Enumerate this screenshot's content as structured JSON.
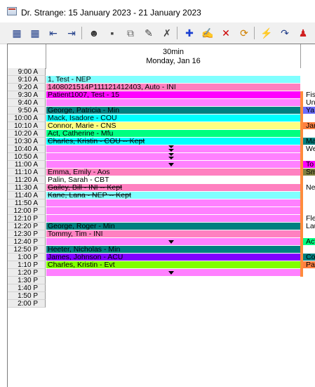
{
  "window": {
    "title": "Dr. Strange: 15 January 2023 - 21 January 2023"
  },
  "toolbar": {
    "buttons": [
      {
        "name": "day-view-icon",
        "glyph": "▦",
        "color": "#1f3c88"
      },
      {
        "name": "week-view-icon",
        "glyph": "▦",
        "color": "#1f3c88"
      },
      {
        "name": "prev-period-icon",
        "glyph": "⇤",
        "color": "#1f3c88"
      },
      {
        "name": "next-period-icon",
        "glyph": "⇥",
        "color": "#1f3c88"
      },
      {
        "name": "find-patient-icon",
        "glyph": "☻",
        "color": "#333333"
      },
      {
        "name": "move-icon",
        "glyph": "▪",
        "color": "#444444"
      },
      {
        "name": "copy-icon",
        "glyph": "⧉",
        "color": "#666666"
      },
      {
        "name": "edit-patient-icon",
        "glyph": "✎",
        "color": "#444444"
      },
      {
        "name": "tools-icon",
        "glyph": "✗",
        "color": "#444444"
      },
      {
        "name": "add-appointment-icon",
        "glyph": "✚",
        "color": "#1a3fd1"
      },
      {
        "name": "edit-appointment-icon",
        "glyph": "✍",
        "color": "#333333"
      },
      {
        "name": "delete-appointment-icon",
        "glyph": "✕",
        "color": "#cc0000"
      },
      {
        "name": "refresh-icon",
        "glyph": "⟳",
        "color": "#d08000"
      },
      {
        "name": "flash-icon",
        "glyph": "⚡",
        "color": "#e0b000"
      },
      {
        "name": "redo-icon",
        "glyph": "↷",
        "color": "#1f3c88"
      },
      {
        "name": "user-alert-icon",
        "glyph": "♟",
        "color": "#d02020"
      }
    ]
  },
  "column": {
    "interval": "30min",
    "date": "Monday, Jan 16"
  },
  "slots": [
    {
      "time": "9:00 A",
      "text": "",
      "color": "#ffffff",
      "marker": "",
      "strike": false,
      "side": "",
      "side_color": "#ffffff",
      "strip": "#ffffff"
    },
    {
      "time": "9:10 A",
      "text": "1, Test -  NEP",
      "color": "#80ffff",
      "marker": "",
      "strike": false,
      "side": "",
      "side_color": "#ffffff",
      "strip": "#ffffff"
    },
    {
      "time": "9:20 A",
      "text": "1408021514P111121412403, Auto -  INI",
      "color": "#ff80c0",
      "marker": "",
      "strike": false,
      "side": "",
      "side_color": "#ffffff",
      "strip": "#ffffff"
    },
    {
      "time": "9:30 A",
      "text": "Patient1007, Test -  15",
      "color": "#ff00ff",
      "marker": "",
      "strike": false,
      "side": "Fis",
      "side_color": "#ffffff",
      "strip": "#ff8c3c"
    },
    {
      "time": "9:40 A",
      "text": "",
      "color": "#ff80ff",
      "marker": "",
      "strike": false,
      "side": "Un",
      "side_color": "#ffffff",
      "strip": "#ff8c3c"
    },
    {
      "time": "9:50 A",
      "text": "George, Patricia -  Min",
      "color": "#008080",
      "marker": "",
      "strike": false,
      "side": "Ya",
      "side_color": "#6a6cff",
      "strip": "#ff8c3c"
    },
    {
      "time": "10:00 A",
      "text": "Mack, Isadore -  COU",
      "color": "#00ffff",
      "marker": "",
      "strike": false,
      "side": "",
      "side_color": "#ffffff",
      "strip": "#ff8c3c"
    },
    {
      "time": "10:10 A",
      "text": "Connor, Marie -  CNS",
      "color": "#ffff80",
      "marker": "",
      "strike": false,
      "side": "Jar",
      "side_color": "#ff8040",
      "strip": "#ff8c3c"
    },
    {
      "time": "10:20 A",
      "text": "Act, Catherine -  Mfu",
      "color": "#00ff80",
      "marker": "",
      "strike": false,
      "side": "",
      "side_color": "#ffffff",
      "strip": "#ff8c3c"
    },
    {
      "time": "10:30 A",
      "text": "Charles, Kristin -  COU -- Kept",
      "color": "#00ffff",
      "marker": "",
      "strike": true,
      "side": "Ma",
      "side_color": "#008080",
      "strip": "#ff8c3c"
    },
    {
      "time": "10:40 A",
      "text": "",
      "color": "#ff80ff",
      "marker": "multi",
      "strike": false,
      "side": "We",
      "side_color": "#ffffff",
      "strip": "#ff8c3c"
    },
    {
      "time": "10:50 A",
      "text": "",
      "color": "#ff80ff",
      "marker": "multi",
      "strike": false,
      "side": "",
      "side_color": "#ffffff",
      "strip": "#ff8c3c"
    },
    {
      "time": "11:00 A",
      "text": "",
      "color": "#ff80ff",
      "marker": "tri",
      "strike": false,
      "side": "To",
      "side_color": "#ff00ff",
      "strip": "#ff8c3c"
    },
    {
      "time": "11:10 A",
      "text": "Emma, Emily -  Aos",
      "color": "#ff80c0",
      "marker": "",
      "strike": false,
      "side": "Sm",
      "side_color": "#808040",
      "strip": "#ff8c3c"
    },
    {
      "time": "11:20 A",
      "text": "Palin, Sarah -  CBT",
      "color": "#ffffff",
      "marker": "",
      "strike": false,
      "side": "",
      "side_color": "#ffffff",
      "strip": "#ff8c3c"
    },
    {
      "time": "11:30 A",
      "text": "Gailey, Bill -  INI -- Kept",
      "color": "#ff80c0",
      "marker": "",
      "strike": true,
      "side": "Ne",
      "side_color": "#ffffff",
      "strip": "#ff8c3c"
    },
    {
      "time": "11:40 A",
      "text": "Kane, Lana -  NEP -- Kept",
      "color": "#80ffff",
      "marker": "",
      "strike": true,
      "side": "",
      "side_color": "#ffffff",
      "strip": "#ff8c3c"
    },
    {
      "time": "11:50 A",
      "text": "",
      "color": "#ff80ff",
      "marker": "",
      "strike": false,
      "side": "",
      "side_color": "#ffffff",
      "strip": "#ff8c3c"
    },
    {
      "time": "12:00 P",
      "text": "",
      "color": "#ff80ff",
      "marker": "",
      "strike": false,
      "side": "",
      "side_color": "#ffffff",
      "strip": "#ff8c3c"
    },
    {
      "time": "12:10 P",
      "text": "",
      "color": "#ff80ff",
      "marker": "",
      "strike": false,
      "side": "Fle",
      "side_color": "#ffffff",
      "strip": "#ff8c3c"
    },
    {
      "time": "12:20 P",
      "text": "George, Roger -  Min",
      "color": "#008080",
      "marker": "",
      "strike": false,
      "side": "Lau",
      "side_color": "#ffffff",
      "strip": "#ff8c3c"
    },
    {
      "time": "12:30 P",
      "text": "Tommy, Tim -  INI",
      "color": "#ff80c0",
      "marker": "",
      "strike": false,
      "side": "",
      "side_color": "#ffffff",
      "strip": "#ff8c3c"
    },
    {
      "time": "12:40 P",
      "text": "",
      "color": "#ff80ff",
      "marker": "tri",
      "strike": false,
      "side": "Act",
      "side_color": "#00ff80",
      "strip": "#ff8c3c"
    },
    {
      "time": "12:50 P",
      "text": "Heeter, Nicholas -  Min",
      "color": "#008080",
      "marker": "",
      "strike": false,
      "side": "",
      "side_color": "#ffffff",
      "strip": "#ff8c3c"
    },
    {
      "time": "1:00 P",
      "text": "James, Johnson -  ACU",
      "color": "#8000ff",
      "marker": "",
      "strike": false,
      "side": "Co",
      "side_color": "#008080",
      "strip": "#ff8c3c"
    },
    {
      "time": "1:10 P",
      "text": "Charles, Kristin -  Evt",
      "color": "#80ff00",
      "marker": "",
      "strike": false,
      "side": "Pa",
      "side_color": "#ff8040",
      "strip": "#ff8c3c"
    },
    {
      "time": "1:20 P",
      "text": "",
      "color": "#ff80ff",
      "marker": "tri",
      "strike": false,
      "side": "",
      "side_color": "#ffffff",
      "strip": "#ff8c3c"
    },
    {
      "time": "1:30 P",
      "text": "",
      "color": "#ffffff",
      "marker": "",
      "strike": false,
      "side": "",
      "side_color": "#ffffff",
      "strip": "#ffffff"
    },
    {
      "time": "1:40 P",
      "text": "",
      "color": "#ffffff",
      "marker": "",
      "strike": false,
      "side": "",
      "side_color": "#ffffff",
      "strip": "#ffffff"
    },
    {
      "time": "1:50 P",
      "text": "",
      "color": "#ffffff",
      "marker": "",
      "strike": false,
      "side": "",
      "side_color": "#ffffff",
      "strip": "#ffffff"
    },
    {
      "time": "2:00 P",
      "text": "",
      "color": "#ffffff",
      "marker": "",
      "strike": false,
      "side": "",
      "side_color": "#ffffff",
      "strip": "#ffffff"
    }
  ]
}
